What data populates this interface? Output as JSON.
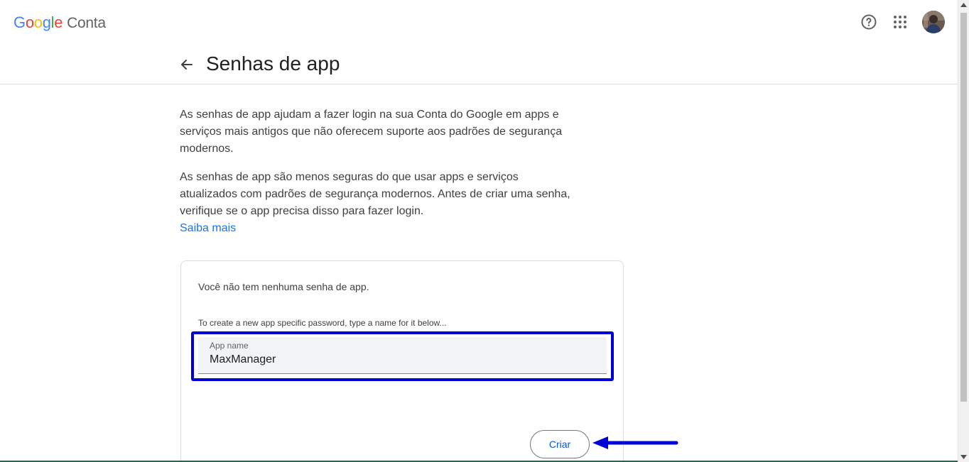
{
  "header": {
    "logo_google": "Google",
    "logo_product": "Conta",
    "help_icon": "help-icon",
    "apps_icon": "apps-grid-icon",
    "avatar_icon": "avatar"
  },
  "page": {
    "title": "Senhas de app",
    "back_icon": "arrow-back-icon"
  },
  "content": {
    "paragraph1": "As senhas de app ajudam a fazer login na sua Conta do Google em apps e serviços mais antigos que não oferecem suporte aos padrões de segurança modernos.",
    "paragraph2": "As senhas de app são menos seguras do que usar apps e serviços atualizados com padrões de segurança modernos. Antes de criar uma senha, verifique se o app precisa disso para fazer login.",
    "learn_more": "Saiba mais"
  },
  "card": {
    "empty_message": "Você não tem nenhuma senha de app.",
    "hint": "To create a new app specific password, type a name for it below...",
    "field_label": "App name",
    "field_value": "MaxManager",
    "create_button": "Criar"
  },
  "colors": {
    "accent_blue": "#1a73e8",
    "button_text": "#0b57d0",
    "annotation_blue": "#0000d6"
  }
}
